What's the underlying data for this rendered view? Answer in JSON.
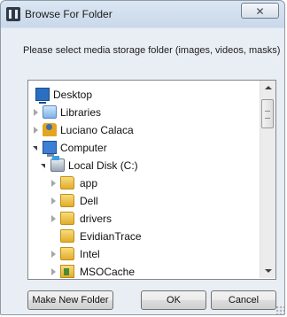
{
  "window": {
    "title": "Browse For Folder",
    "close_label": "✕"
  },
  "instruction": "Please select media storage folder (images, videos, masks)",
  "tree": {
    "items": [
      {
        "label": "Desktop",
        "icon": "desktop-icon",
        "level": 0,
        "expander": "none"
      },
      {
        "label": "Libraries",
        "icon": "libraries-icon",
        "level": 0,
        "expander": "collapsed"
      },
      {
        "label": "Luciano Calaca",
        "icon": "user-folder-icon",
        "level": 0,
        "expander": "collapsed"
      },
      {
        "label": "Computer",
        "icon": "computer-icon",
        "level": 0,
        "expander": "expanded"
      },
      {
        "label": "Local Disk (C:)",
        "icon": "local-disk-icon",
        "level": 1,
        "expander": "expanded"
      },
      {
        "label": "app",
        "icon": "folder-icon",
        "level": 2,
        "expander": "collapsed"
      },
      {
        "label": "Dell",
        "icon": "folder-icon",
        "level": 2,
        "expander": "collapsed"
      },
      {
        "label": "drivers",
        "icon": "folder-icon",
        "level": 2,
        "expander": "collapsed"
      },
      {
        "label": "EvidianTrace",
        "icon": "folder-icon",
        "level": 2,
        "expander": "none"
      },
      {
        "label": "Intel",
        "icon": "folder-icon",
        "level": 2,
        "expander": "collapsed"
      },
      {
        "label": "MSOCache",
        "icon": "folder-icon",
        "level": 2,
        "expander": "collapsed"
      }
    ]
  },
  "buttons": {
    "make_new_folder": "Make New Folder",
    "ok": "OK",
    "cancel": "Cancel"
  }
}
